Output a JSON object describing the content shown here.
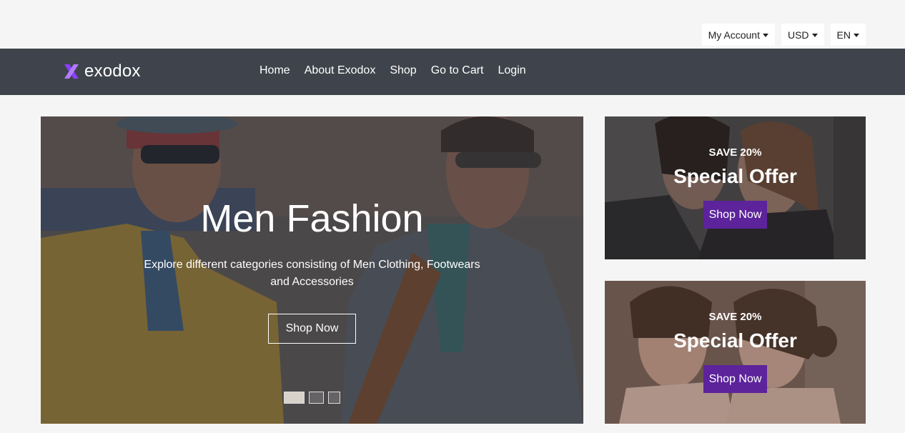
{
  "topbar": {
    "account": "My Account",
    "currency": "USD",
    "language": "EN"
  },
  "brand": {
    "name": "exodox",
    "accent": "#8a3ffc"
  },
  "nav": {
    "items": [
      "Home",
      "About Exodox",
      "Shop",
      "Go to Cart",
      "Login"
    ]
  },
  "hero": {
    "title": "Men Fashion",
    "subtitle": "Explore different categories consisting of Men Clothing, Footwears and Accessories",
    "button": "Shop Now",
    "slides_count": 3,
    "active_slide": 1
  },
  "offers": [
    {
      "save": "SAVE 20%",
      "title": "Special Offer",
      "button": "Shop Now"
    },
    {
      "save": "SAVE 20%",
      "title": "Special Offer",
      "button": "Shop Now"
    }
  ],
  "colors": {
    "navbar": "#3f444c",
    "offer_button": "#5c239b",
    "page_bg": "#f5f5f5"
  }
}
